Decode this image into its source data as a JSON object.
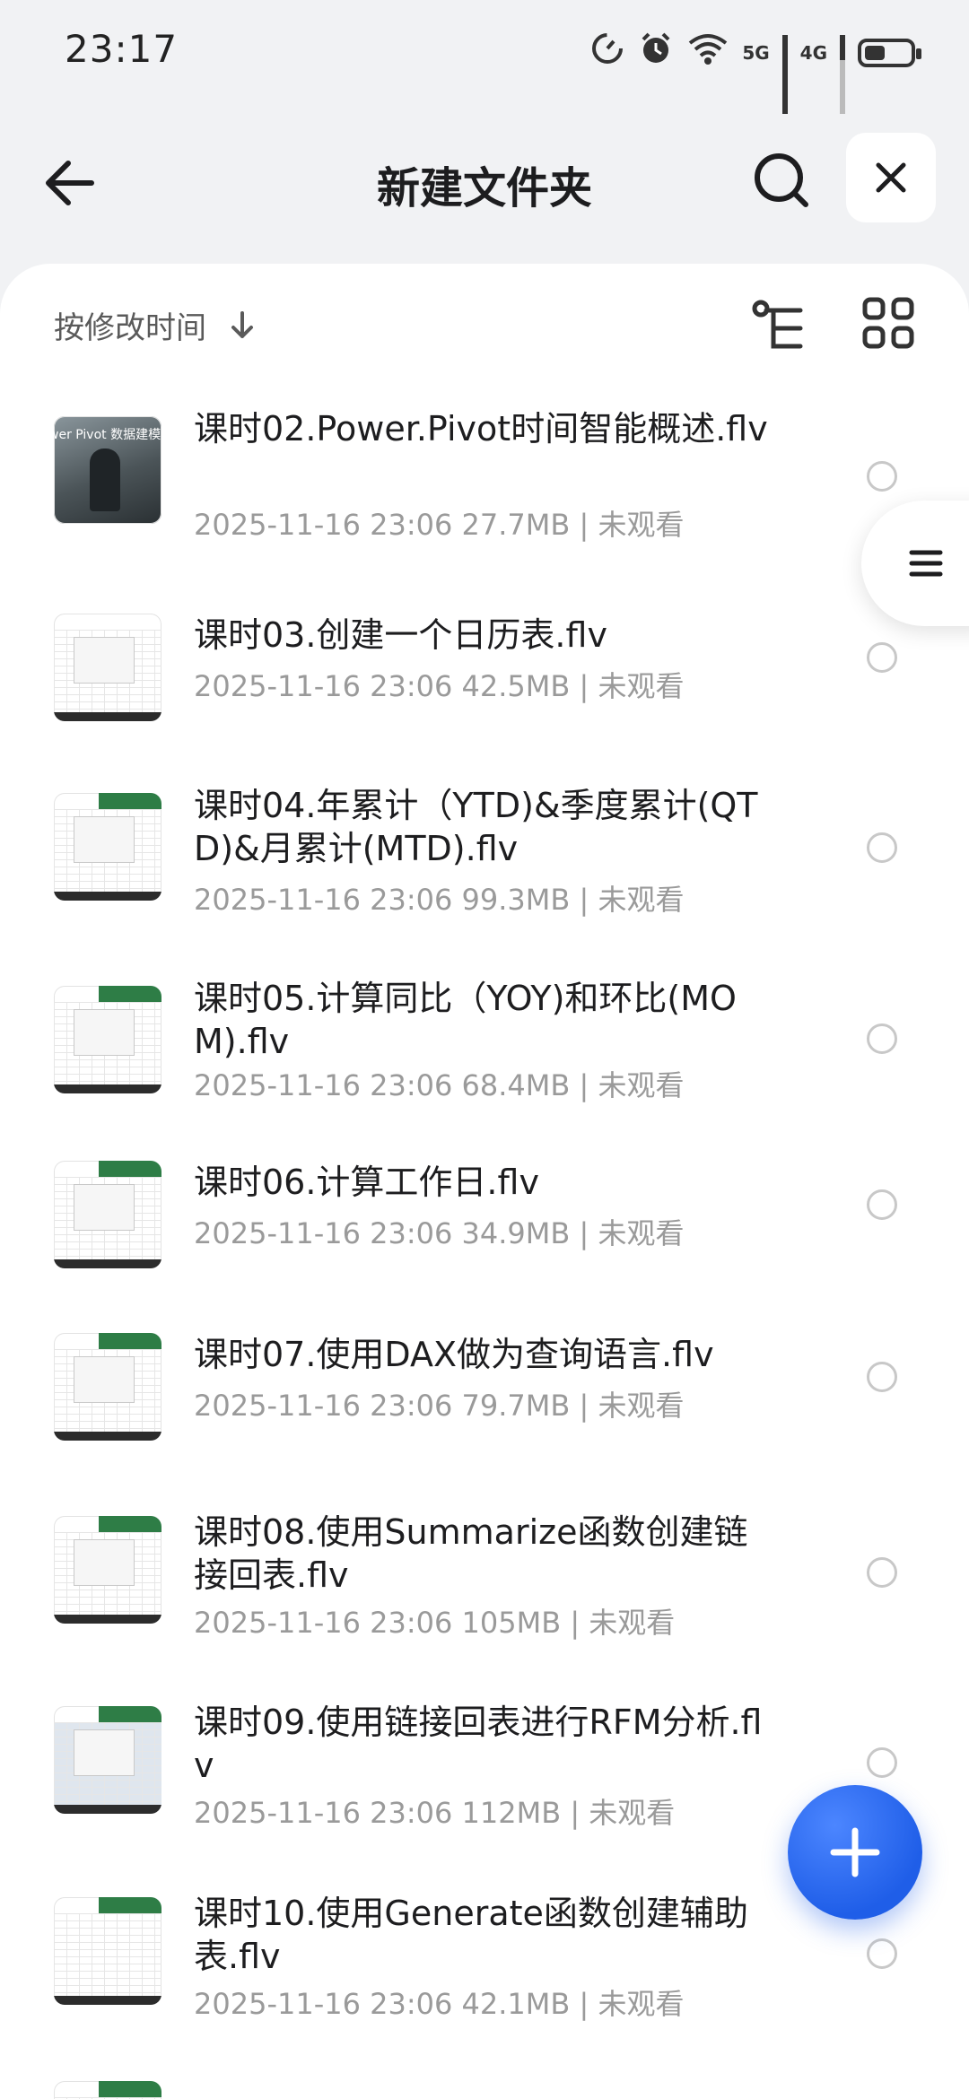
{
  "status_bar": {
    "time": "23:17",
    "network_5g": "5G",
    "network_4g": "4G",
    "battery_level": 0.45
  },
  "header": {
    "title": "新建文件夹",
    "icons": [
      "back-arrow-icon",
      "search-icon",
      "close-icon"
    ]
  },
  "toolbar": {
    "sort_label": "按修改时间",
    "icons": [
      "sort-down-arrow-icon",
      "tree-view-icon",
      "grid-view-icon"
    ]
  },
  "files": [
    {
      "name": "课时02.Power.Pivot时间智能概述.flv",
      "date": "2025-11-16 23:06",
      "size": "27.7MB",
      "status": "未观看",
      "thumb_text": "wer Pivot 数据建模分析（ —年度…实用的Power Pivot"
    },
    {
      "name": "课时03.创建一个日历表.flv",
      "date": "2025-11-16 23:06",
      "size": "42.5MB",
      "status": "未观看"
    },
    {
      "name": "课时04.年累计（YTD)&季度累计(QTD)&月累计(MTD).flv",
      "date": "2025-11-16 23:06",
      "size": "99.3MB",
      "status": "未观看"
    },
    {
      "name": "课时05.计算同比（YOY)和环比(MOM).flv",
      "date": "2025-11-16 23:06",
      "size": "68.4MB",
      "status": "未观看"
    },
    {
      "name": "课时06.计算工作日.flv",
      "date": "2025-11-16 23:06",
      "size": "34.9MB",
      "status": "未观看"
    },
    {
      "name": "课时07.使用DAX做为查询语言.flv",
      "date": "2025-11-16 23:06",
      "size": "79.7MB",
      "status": "未观看"
    },
    {
      "name": "课时08.使用Summarize函数创建链接回表.flv",
      "date": "2025-11-16 23:06",
      "size": "105MB",
      "status": "未观看"
    },
    {
      "name": "课时09.使用链接回表进行RFM分析.flv",
      "date": "2025-11-16 23:06",
      "size": "112MB",
      "status": "未观看"
    },
    {
      "name": "课时10.使用Generate函数创建辅助表.flv",
      "date": "2025-11-16 23:06",
      "size": "42.1MB",
      "status": "未观看"
    }
  ],
  "floating": {
    "icons": [
      "menu-icon",
      "add-icon"
    ]
  },
  "colors": {
    "accent": "#1f5ee8",
    "background": "#f1f2f4",
    "meta_text": "#9a9a9a"
  }
}
